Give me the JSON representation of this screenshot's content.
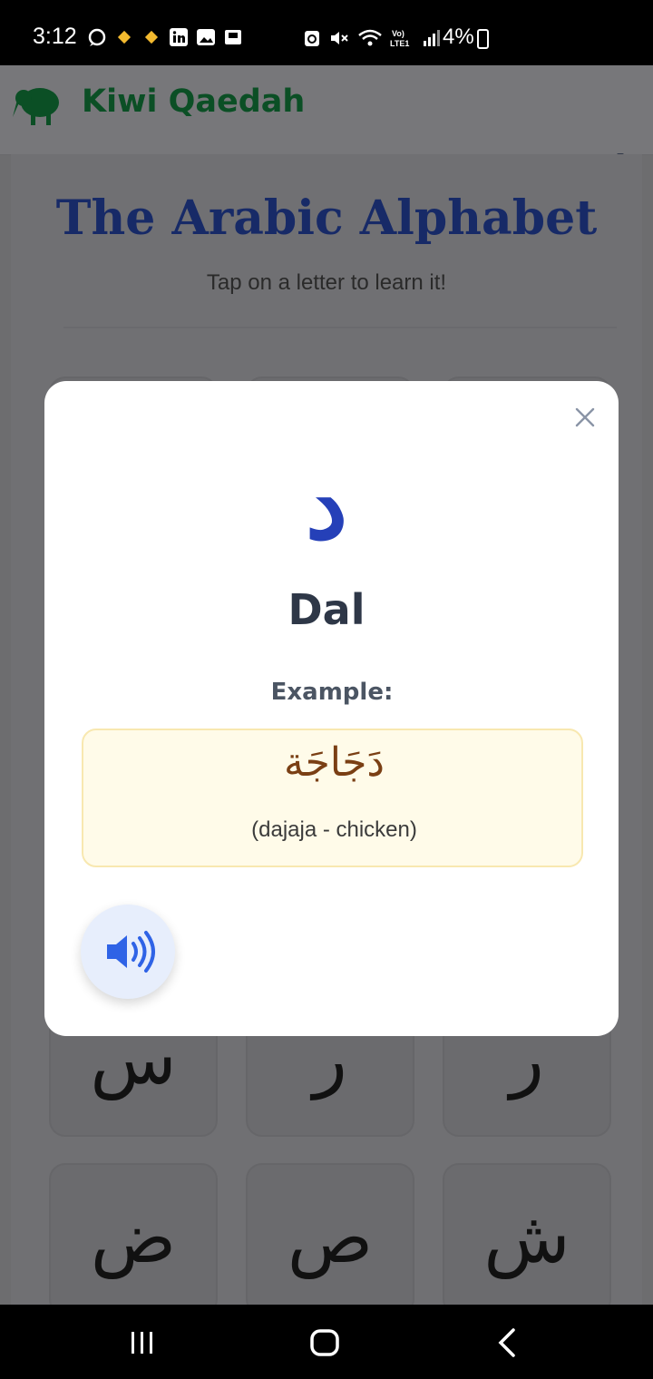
{
  "status_bar": {
    "time": "3:12",
    "battery": "4%",
    "icons_left": [
      "whatsapp-icon",
      "binance-icon",
      "binance-icon",
      "linkedin-icon",
      "gallery-icon",
      "app-icon"
    ],
    "icons_right": [
      "recycle-icon",
      "mute-icon",
      "wifi-icon",
      "volte-icon",
      "signal-icon",
      "battery-icon"
    ],
    "network_label": "Vo) LTE1"
  },
  "app_bar": {
    "title": "Kiwi Qaedah",
    "logo_icon": "kiwi-bird-icon",
    "settings_icon": "gear-icon"
  },
  "page": {
    "title": "The Arabic Alphabet",
    "subtitle": "Tap on a letter to learn it!"
  },
  "letter_grid": {
    "visible_row_1": [
      "س",
      "ر",
      "ر"
    ],
    "visible_row_2": [
      "ض",
      "ص",
      "ش"
    ]
  },
  "modal": {
    "letter": "د",
    "name": "Dal",
    "example_label": "Example:",
    "example_word": "دَجَاجَة",
    "example_translit": "(dajaja - chicken)",
    "close_icon": "close-icon",
    "audio_icon": "speaker-icon"
  },
  "colors": {
    "brand_green": "#0b4f25",
    "title_navy": "#172a67",
    "letter_blue": "#2540b8",
    "example_bg": "#fffbe9",
    "example_text": "#7a3f14"
  },
  "nav_bar": {
    "recent_icon": "recent-apps-icon",
    "home_icon": "home-icon",
    "back_icon": "back-icon"
  }
}
